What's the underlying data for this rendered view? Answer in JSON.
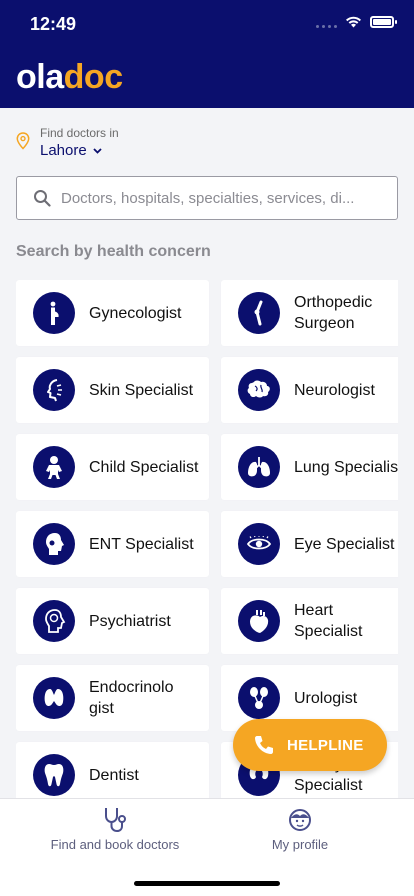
{
  "status_bar": {
    "time": "12:49"
  },
  "brand": {
    "logo_part1": "ola",
    "logo_d": "d",
    "logo_o": "o",
    "logo_c": "c",
    "accent_color": "#f5a623",
    "primary_color": "#0b0f6e"
  },
  "location": {
    "label": "Find doctors in",
    "city": "Lahore",
    "pin_icon": "map-pin-icon",
    "chevron_icon": "chevron-down-icon"
  },
  "search": {
    "placeholder": "Doctors, hospitals, specialties, services, di..."
  },
  "section": {
    "title": "Search by health concern"
  },
  "concerns": [
    {
      "label": "Gynecologist",
      "icon": "pregnant-woman-icon"
    },
    {
      "label": "Orthopedic Surgeon",
      "icon": "bone-joint-icon"
    },
    {
      "label": "Skin Specialist",
      "icon": "face-skin-icon"
    },
    {
      "label": "Neurologist",
      "icon": "brain-icon"
    },
    {
      "label": "Child Specialist",
      "icon": "baby-icon"
    },
    {
      "label": "Lung Specialist",
      "icon": "lungs-icon"
    },
    {
      "label": "ENT Specialist",
      "icon": "head-throat-icon"
    },
    {
      "label": "Eye Specialist",
      "icon": "eye-icon"
    },
    {
      "label": "Psychiatrist",
      "icon": "head-mind-icon"
    },
    {
      "label": "Heart Specialist",
      "icon": "heart-icon"
    },
    {
      "label": "Endocrinolo gist",
      "icon": "thyroid-icon"
    },
    {
      "label": "Urologist",
      "icon": "kidney-bladder-icon"
    },
    {
      "label": "Dentist",
      "icon": "tooth-icon"
    },
    {
      "label": "Kidney Specialist",
      "icon": "kidneys-icon"
    }
  ],
  "helpline": {
    "label": "HELPLINE",
    "icon": "phone-icon"
  },
  "tabbar": {
    "find": {
      "label": "Find and book doctors",
      "icon": "stethoscope-icon"
    },
    "profile": {
      "label": "My profile",
      "icon": "profile-face-icon"
    }
  }
}
